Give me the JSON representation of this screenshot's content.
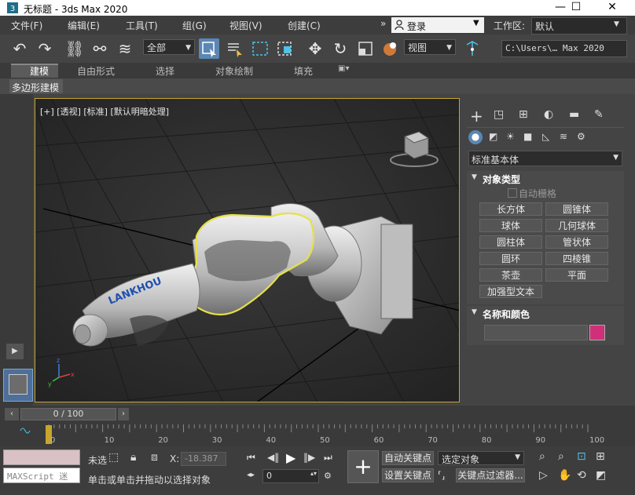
{
  "window": {
    "title": "无标题 - 3ds Max 2020",
    "minimize": "—",
    "maximize": "☐",
    "close": "✕"
  },
  "menu": {
    "items": [
      "文件(F)",
      "编辑(E)",
      "工具(T)",
      "组(G)",
      "视图(V)",
      "创建(C)"
    ],
    "more": "»",
    "login_label": "登录",
    "workspace_label": "工作区:",
    "workspace_value": "默认"
  },
  "toolbar": {
    "selection_filter": "全部",
    "ref_coord": "视图",
    "path_field": "C:\\Users\\… Max 2020"
  },
  "ribbon": {
    "tabs": [
      "建模",
      "自由形式",
      "选择",
      "对象绘制",
      "填充"
    ],
    "sub_label": "多边形建模"
  },
  "viewport": {
    "label": "[+] [透视] [标准] [默认明暗处理]",
    "robot_brand": "LANKHOU"
  },
  "command_panel": {
    "category": "标准基本体",
    "object_type_title": "对象类型",
    "autogrid_label": "自动栅格",
    "objects": [
      "长方体",
      "圆锥体",
      "球体",
      "几何球体",
      "圆柱体",
      "管状体",
      "圆环",
      "四棱锥",
      "茶壶",
      "平面",
      "加强型文本"
    ],
    "name_color_title": "名称和颜色",
    "object_color": "#d0307a"
  },
  "timeline": {
    "frame_label": "0 / 100",
    "ticks": [
      "0",
      "10",
      "20",
      "30",
      "40",
      "50",
      "60",
      "70",
      "80",
      "90",
      "100"
    ]
  },
  "status": {
    "maxscript_placeholder": "MAXScript 迷",
    "selection_state": "未选",
    "x_label": "X:",
    "x_value": "-18.387",
    "prompt": "单击或单击并拖动以选择对象",
    "frame_value": "0",
    "auto_key": "自动关键点",
    "set_key": "设置关键点",
    "selected_object": "选定对象",
    "key_filters": "关键点过滤器..."
  }
}
